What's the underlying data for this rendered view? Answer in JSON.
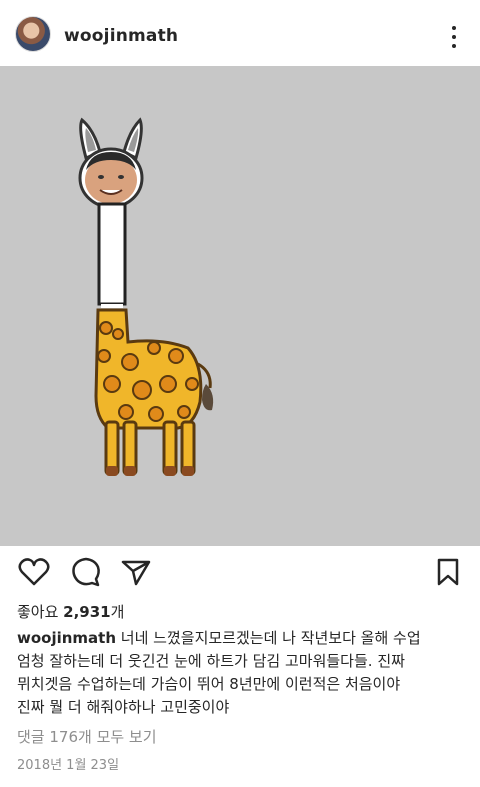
{
  "header": {
    "username": "woojinmath",
    "avatar_icon": "profile-avatar",
    "more_icon": "more-vertical-icon"
  },
  "post": {
    "image_description_icon": "giraffe-illustration",
    "background_color": "#c7c7c7"
  },
  "actions": {
    "like_icon": "heart-icon",
    "comment_icon": "comment-icon",
    "share_icon": "send-icon",
    "save_icon": "bookmark-icon"
  },
  "likes": {
    "prefix": "좋아요 ",
    "count": "2,931",
    "suffix": "개"
  },
  "caption": {
    "username": "woojinmath",
    "line1": " 너네 느꼈을지모르겠는데 나 작년보다 올해 수업",
    "line2": "엄청 잘하는데 더 웃긴건 눈에 하트가 담김 고마워들다들.  진짜",
    "line3": "뮈치겟음 수업하는데 가슴이 뛰어 8년만에 이런적은 처음이야",
    "line4": "진짜 뭘 더 해줘야하나 고민중이야"
  },
  "comments": {
    "label": "댓글 176개 모두 보기"
  },
  "date": {
    "label": "2018년 1월 23일"
  }
}
